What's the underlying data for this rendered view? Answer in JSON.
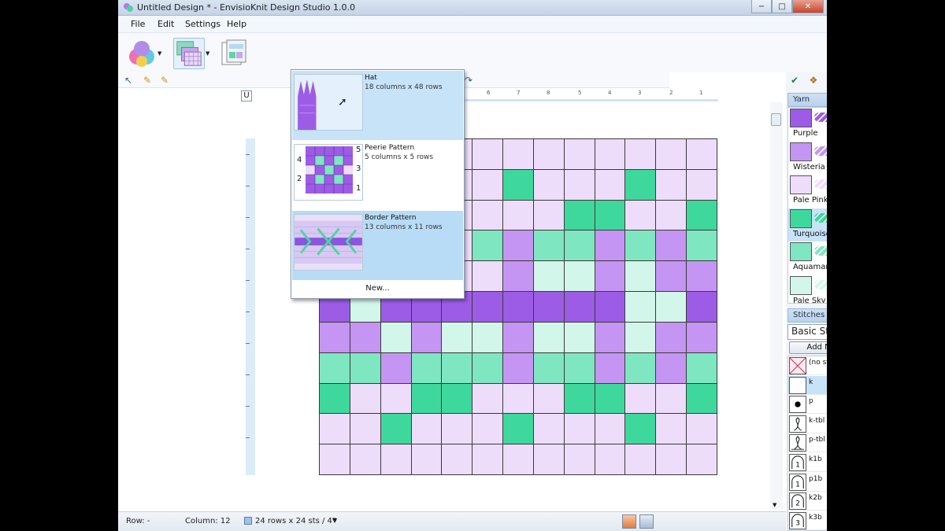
{
  "window": {
    "title": "Untitled Design * - EnvisioKnit Design Studio 1.0.0",
    "minimize_glyph": "−",
    "maximize_glyph": "□",
    "close_glyph": "✕"
  },
  "menu": [
    "File",
    "Edit",
    "Settings",
    "Help"
  ],
  "toolbar": {
    "big_tools": [
      {
        "icon": "yarn-balls-icon"
      },
      {
        "icon": "pattern-grid-icon",
        "selected": true
      },
      {
        "icon": "pattern-sheet-icon"
      }
    ],
    "small_tools_left": [
      "select-arrow-icon",
      "pencil-icon",
      "pencil-alt-icon"
    ],
    "small_tools_right": [
      "zoom-in-icon",
      "zoom-out-icon",
      "cut-icon",
      "copy-icon",
      "paste-icon",
      "undo-icon",
      "redo-icon"
    ]
  },
  "ruler": {
    "top_numbers": [
      "6",
      "7",
      "8",
      "5",
      "4",
      "3",
      "2",
      "1"
    ],
    "u_button": "U"
  },
  "pattern_popup": {
    "items": [
      {
        "title": "Hat",
        "subtitle": "18 columns x 48 rows",
        "selected": true
      },
      {
        "title": "Peerie Pattern",
        "subtitle": "5 columns x 5 rows",
        "row_labels_left": [
          "4",
          "2"
        ],
        "row_labels_right": [
          "5",
          "3",
          "1"
        ]
      },
      {
        "title": "Border Pattern",
        "subtitle": "13 columns x 11 rows",
        "hover": true
      }
    ],
    "new_label": "New..."
  },
  "grid": {
    "columns": 13,
    "rows": 11,
    "colors": {
      "P": "#9d5ce6",
      "W": "#c495f2",
      "L": "#eedcfb",
      "T": "#3fd89c",
      "A": "#7fe6c2",
      "S": "#d2f6ea"
    },
    "cells": [
      "LLLLLLLLLLLLL",
      "LLLLLLTLLLTLL",
      "LLLLLLLLTTLLT",
      "LLLLLAWAAWAWA",
      "LLLLLLWSSWSWW",
      "PSPPPPPPPPSSP",
      "WWSWSSWSSWSWW",
      "AAWAAAWAAWAWA",
      "TLLTTLLLTTLLT",
      "LLTLLLTLLLTLL",
      "LLLLLLLLLLLLL"
    ]
  },
  "status": {
    "row": "Row: -",
    "column": "Column: 12",
    "size": "24 rows x 24 sts / 4\""
  },
  "yarn_panel": {
    "header": "Yarn",
    "items": [
      {
        "name": "Purple",
        "color": "#9d5ce6"
      },
      {
        "name": "Wisteria",
        "color": "#c495f2"
      },
      {
        "name": "Pale Pink",
        "color": "#eedcfb"
      },
      {
        "name": "Turquoise",
        "color": "#3fd89c",
        "selected": true
      },
      {
        "name": "Aquamarine",
        "color": "#7fe6c2"
      },
      {
        "name": "Pale Sky Blue",
        "color": "#d2f6ea"
      }
    ]
  },
  "stitches_panel": {
    "header": "Stitches",
    "selected_set": "Basic Stitches",
    "add_button": "Add New Basic Stitches...",
    "items": [
      {
        "label": "(no stitch)",
        "symbol": "no-stitch-icon"
      },
      {
        "label": "k",
        "symbol": "knit-icon",
        "selected": true
      },
      {
        "label": "p",
        "symbol": "purl-dot-icon"
      },
      {
        "label": "k-tbl",
        "symbol": "knit-tbl-icon"
      },
      {
        "label": "p-tbl",
        "symbol": "purl-tbl-icon"
      },
      {
        "label": "k1b",
        "symbol": "k1b-icon",
        "glyph": "1"
      },
      {
        "label": "p1b",
        "symbol": "p1b-icon",
        "glyph": "1"
      },
      {
        "label": "k2b",
        "symbol": "k2b-icon",
        "glyph": "2"
      },
      {
        "label": "k3b",
        "symbol": "k3b-icon",
        "glyph": "3"
      }
    ]
  }
}
